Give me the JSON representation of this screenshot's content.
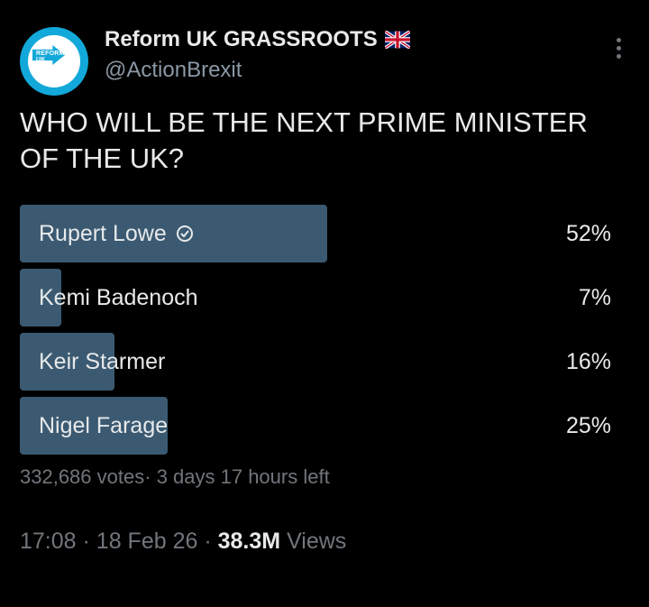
{
  "author": {
    "display_name": "Reform UK GRASSROOTS",
    "handle": "@ActionBrexit",
    "flag_icon": "union-jack-flag-icon",
    "avatar_text": "REFORM UK"
  },
  "menu_icon": "more-vertical-icon",
  "tweet": {
    "text_line1": "WHO WILL BE THE NEXT PRIME MINISTER",
    "text_line2": "OF THE UK?"
  },
  "poll": {
    "options": [
      {
        "label": "Rupert Lowe",
        "pct_text": "52%",
        "pct": 52,
        "selected": true
      },
      {
        "label": "Kemi Badenoch",
        "pct_text": "7%",
        "pct": 7,
        "selected": false
      },
      {
        "label": "Keir Starmer",
        "pct_text": "16%",
        "pct": 16,
        "selected": false
      },
      {
        "label": "Nigel Farage",
        "pct_text": "25%",
        "pct": 25,
        "selected": false
      }
    ],
    "votes": "332,686 votes",
    "time_left": "3 days 17 hours left",
    "bar_color": "#3b5a72"
  },
  "footer": {
    "time": "17:08",
    "date": "18 Feb 26",
    "views_count": "38.3M",
    "views_label": "Views"
  }
}
